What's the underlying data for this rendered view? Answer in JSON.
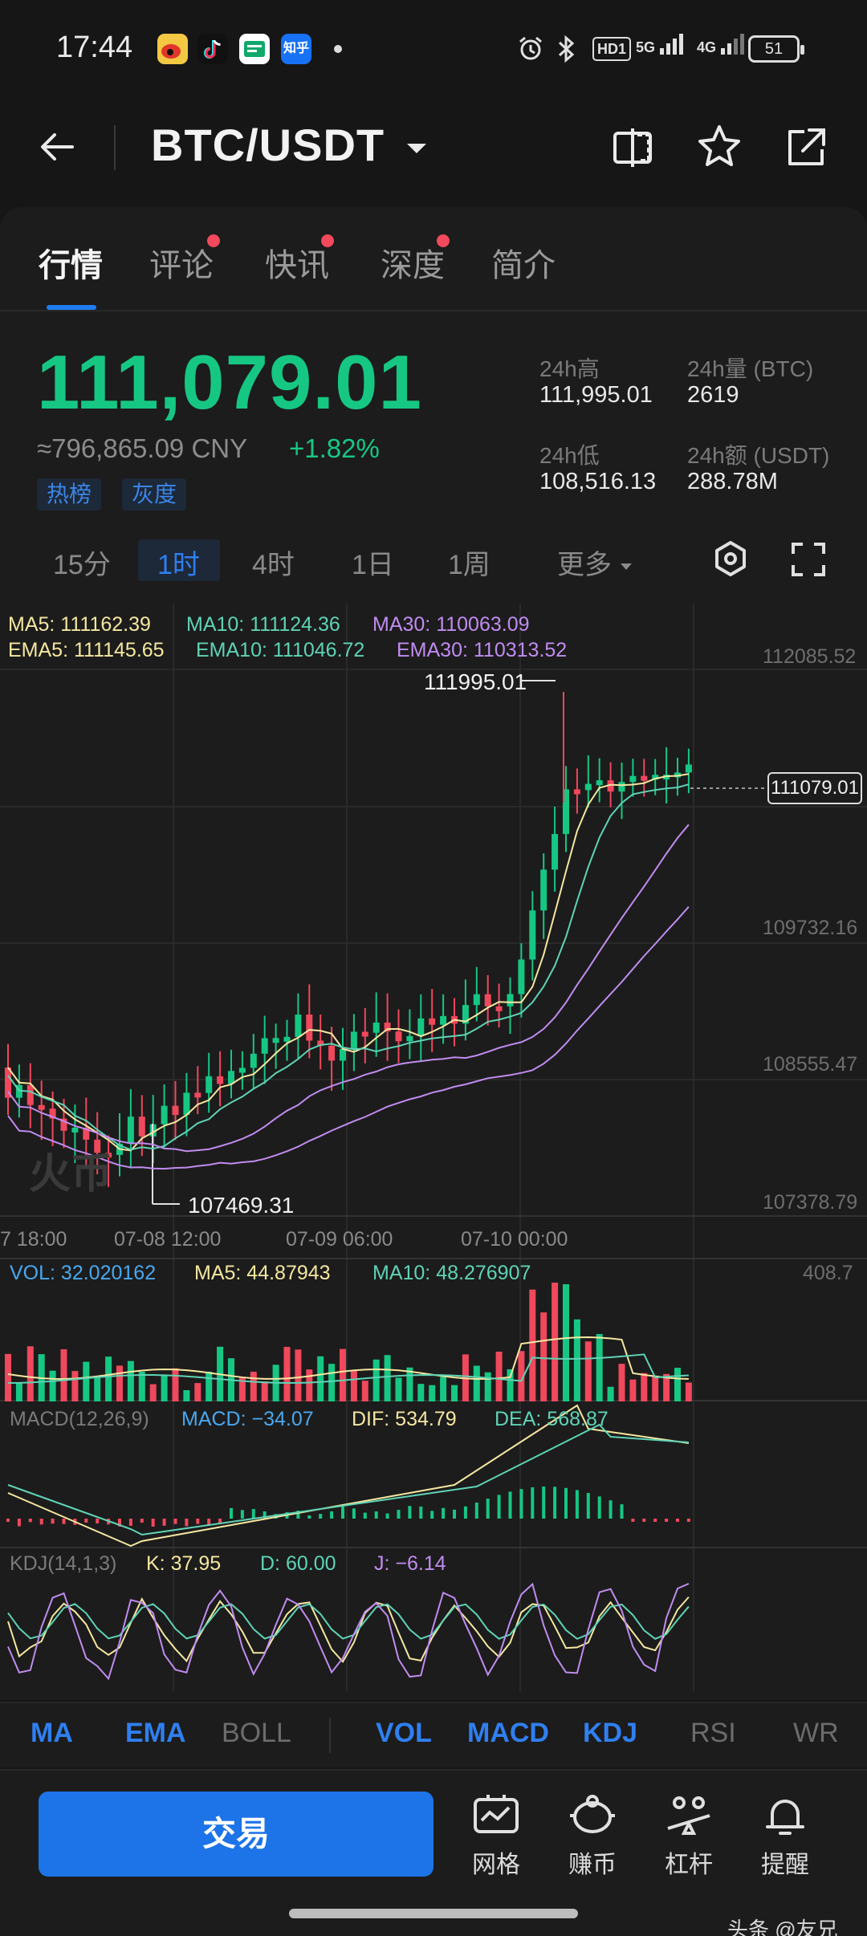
{
  "status_bar": {
    "time": "17:44",
    "network_badges": [
      "HD1",
      "5G",
      "4G"
    ],
    "battery": "51",
    "app_icons": [
      {
        "name": "weibo-app-icon",
        "color": "#f9d04c"
      },
      {
        "name": "douyin-app-icon",
        "color": "#111111"
      },
      {
        "name": "app-green-icon",
        "color": "#0fa86b"
      },
      {
        "name": "zhihu-app-icon",
        "color": "#1772f6",
        "text": "知乎"
      }
    ]
  },
  "header": {
    "pair": "BTC/USDT"
  },
  "tabs": [
    {
      "label": "行情",
      "active": true,
      "dot": false
    },
    {
      "label": "评论",
      "active": false,
      "dot": true
    },
    {
      "label": "快讯",
      "active": false,
      "dot": true
    },
    {
      "label": "深度",
      "active": false,
      "dot": true
    },
    {
      "label": "简介",
      "active": false,
      "dot": false
    }
  ],
  "ticker": {
    "price": "111,079.01",
    "cny": "≈796,865.09 CNY",
    "change": "+1.82%",
    "tags": [
      "热榜",
      "灰度"
    ],
    "high_label": "24h高",
    "high": "111,995.01",
    "low_label": "24h低",
    "low": "108,516.13",
    "vol_label": "24h量 (BTC)",
    "vol": "2619",
    "amt_label": "24h额 (USDT)",
    "amt": "288.78M"
  },
  "intervals": [
    "15分",
    "1时",
    "4时",
    "1日",
    "1周",
    "更多"
  ],
  "active_interval": "1时",
  "chart_labels": {
    "ma5": "MA5: 111162.39",
    "ma10": "MA10: 111124.36",
    "ma30": "MA30: 110063.09",
    "ema5": "EMA5: 111145.65",
    "ema10": "EMA10: 111046.72",
    "ema30": "EMA30: 110313.52",
    "high_callout": "111995.01",
    "low_callout": "107469.31",
    "current_price": "111079.01",
    "y_ticks": [
      "112085.52",
      "109732.16",
      "108555.47",
      "107378.79"
    ],
    "x_ticks": [
      "7 18:00",
      "07-08 12:00",
      "07-09 06:00",
      "07-10 00:00"
    ],
    "watermark": "火币",
    "vol": "VOL: 32.020162",
    "vol_ma5": "MA5: 44.87943",
    "vol_ma10": "MA10: 48.276907",
    "vol_max": "408.7",
    "macd_title": "MACD(12,26,9)",
    "macd": "MACD: −34.07",
    "dif": "DIF: 534.79",
    "dea": "DEA: 568.87",
    "kdj_title": "KDJ(14,1,3)",
    "k": "K: 37.95",
    "d": "D: 60.00",
    "j": "J: −6.14"
  },
  "colors": {
    "up": "#16c784",
    "down": "#f0485c",
    "ma5": "#f5e7a0",
    "ma10": "#5fd3b5",
    "ma30": "#c08cf0",
    "accent": "#1d74e8"
  },
  "indicators": [
    {
      "label": "MA",
      "on": true
    },
    {
      "label": "EMA",
      "on": true
    },
    {
      "label": "BOLL",
      "on": false
    },
    {
      "label": "VOL",
      "on": true
    },
    {
      "label": "MACD",
      "on": true
    },
    {
      "label": "KDJ",
      "on": true
    },
    {
      "label": "RSI",
      "on": false
    },
    {
      "label": "WR",
      "on": false
    }
  ],
  "bottom": {
    "trade": "交易",
    "items": [
      {
        "label": "网格",
        "icon": "grid-bot-icon"
      },
      {
        "label": "赚币",
        "icon": "piggy-bank-icon"
      },
      {
        "label": "杠杆",
        "icon": "leverage-icon"
      },
      {
        "label": "提醒",
        "icon": "bell-icon"
      }
    ],
    "credit": "头条 @友兄"
  }
}
